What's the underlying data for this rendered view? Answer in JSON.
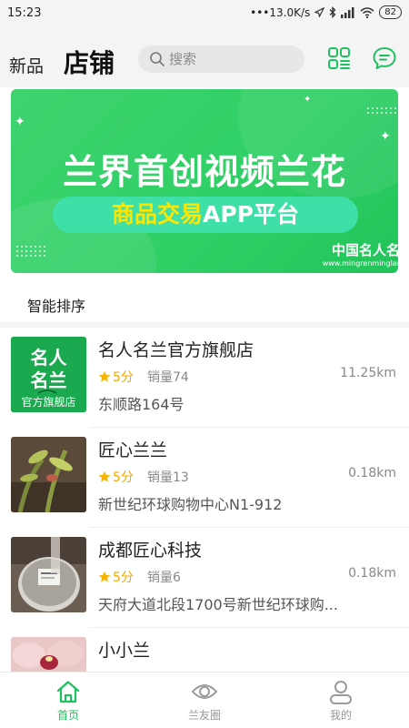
{
  "status_bar": {
    "time": "15:23",
    "network": "•••13.0K/s",
    "battery": "82"
  },
  "header": {
    "tab_new": "新品",
    "tab_shop": "店铺",
    "search_placeholder": "搜索",
    "icons": [
      "grid-apps-icon",
      "message-bubble-icon"
    ],
    "accent_color": "#1ec15f"
  },
  "banner": {
    "title": "兰界首创视频兰花",
    "subtitle_highlight": "商品交易",
    "subtitle_rest": "APP平台",
    "brand": "中国名人名",
    "url": "www.mingrenminglar"
  },
  "sort": {
    "label": "智能排序"
  },
  "shops": [
    {
      "name": "名人名兰官方旗舰店",
      "rating": "5分",
      "sales": "销量74",
      "distance": "11.25km",
      "address": "东顺路164号",
      "thumb_text": [
        "名人",
        "名兰",
        "官方旗舰店"
      ]
    },
    {
      "name": "匠心兰兰",
      "rating": "5分",
      "sales": "销量13",
      "distance": "0.18km",
      "address": "新世纪环球购物中心N1-912"
    },
    {
      "name": "成都匠心科技",
      "rating": "5分",
      "sales": "销量6",
      "distance": "0.18km",
      "address": "天府大道北段1700号新世纪环球购..."
    },
    {
      "name": "小小兰",
      "rating": "",
      "sales": "",
      "distance": "",
      "address": ""
    }
  ],
  "tab_bar": {
    "tabs": [
      {
        "label": "首页",
        "icon": "home-icon",
        "active": true
      },
      {
        "label": "兰友圈",
        "icon": "eye-icon",
        "active": false
      },
      {
        "label": "我的",
        "icon": "user-icon",
        "active": false
      }
    ]
  }
}
